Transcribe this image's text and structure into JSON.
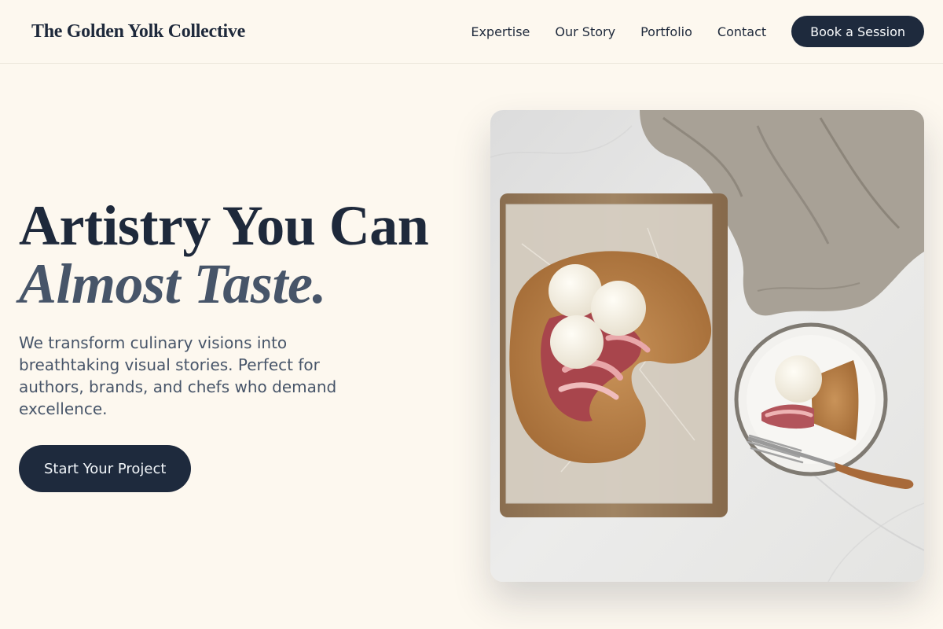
{
  "header": {
    "brand": "The Golden Yolk Collective",
    "nav": [
      {
        "label": "Expertise"
      },
      {
        "label": "Our Story"
      },
      {
        "label": "Portfolio"
      },
      {
        "label": "Contact"
      }
    ],
    "cta_label": "Book a Session"
  },
  "hero": {
    "title_line1": "Artistry You Can",
    "title_line2": "Almost Taste.",
    "description": "We transform culinary visions into breathtaking visual stories. Perfect for authors, brands, and chefs who demand excellence.",
    "cta_label": "Start Your Project",
    "image_subject": "galette-with-ice-cream-photo"
  },
  "colors": {
    "background": "#fdf8ef",
    "primary_dark": "#1e2a3d",
    "muted_text": "#475569"
  }
}
